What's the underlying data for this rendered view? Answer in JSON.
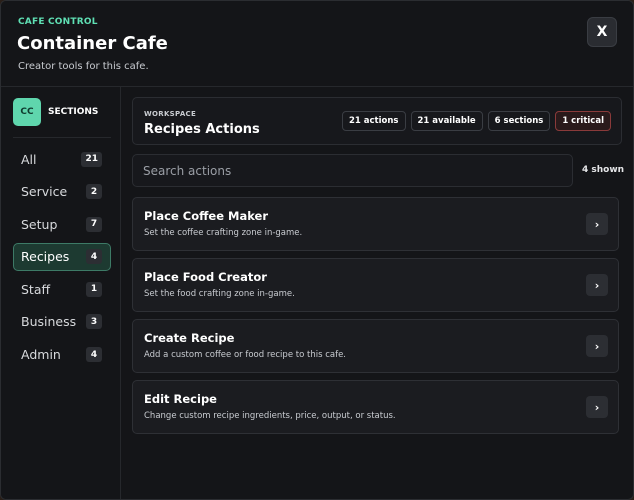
{
  "header": {
    "eyebrow": "CAFE CONTROL",
    "title": "Container Cafe",
    "subtitle": "Creator tools for this cafe.",
    "close_label": "X"
  },
  "sidebar": {
    "badge": "CC",
    "title": "SECTIONS",
    "items": [
      {
        "label": "All",
        "count": "21"
      },
      {
        "label": "Service",
        "count": "2"
      },
      {
        "label": "Setup",
        "count": "7"
      },
      {
        "label": "Recipes",
        "count": "4",
        "active": true
      },
      {
        "label": "Staff",
        "count": "1"
      },
      {
        "label": "Business",
        "count": "3"
      },
      {
        "label": "Admin",
        "count": "4"
      }
    ]
  },
  "workspace": {
    "eyebrow": "WORKSPACE",
    "title": "Recipes Actions",
    "stats": {
      "actions": "21 actions",
      "available": "21 available",
      "sections": "6 sections",
      "critical": "1 critical"
    }
  },
  "search": {
    "placeholder": "Search actions",
    "value": "",
    "shown": "4 shown"
  },
  "actions": [
    {
      "title": "Place Coffee Maker",
      "description": "Set the coffee crafting zone in-game.",
      "chevron": "›"
    },
    {
      "title": "Place Food Creator",
      "description": "Set the food crafting zone in-game.",
      "chevron": "›"
    },
    {
      "title": "Create Recipe",
      "description": "Add a custom coffee or food recipe to this cafe.",
      "chevron": "›"
    },
    {
      "title": "Edit Recipe",
      "description": "Change custom recipe ingredients, price, output, or status.",
      "chevron": "›"
    }
  ],
  "colors": {
    "accent": "#5fe0b4",
    "active_bg": "#1d3a31",
    "critical_border": "#8a3a3a",
    "panel_bg": "#141518"
  },
  "icons": {
    "close": "close-icon",
    "chevron": "chevron-right-icon"
  }
}
